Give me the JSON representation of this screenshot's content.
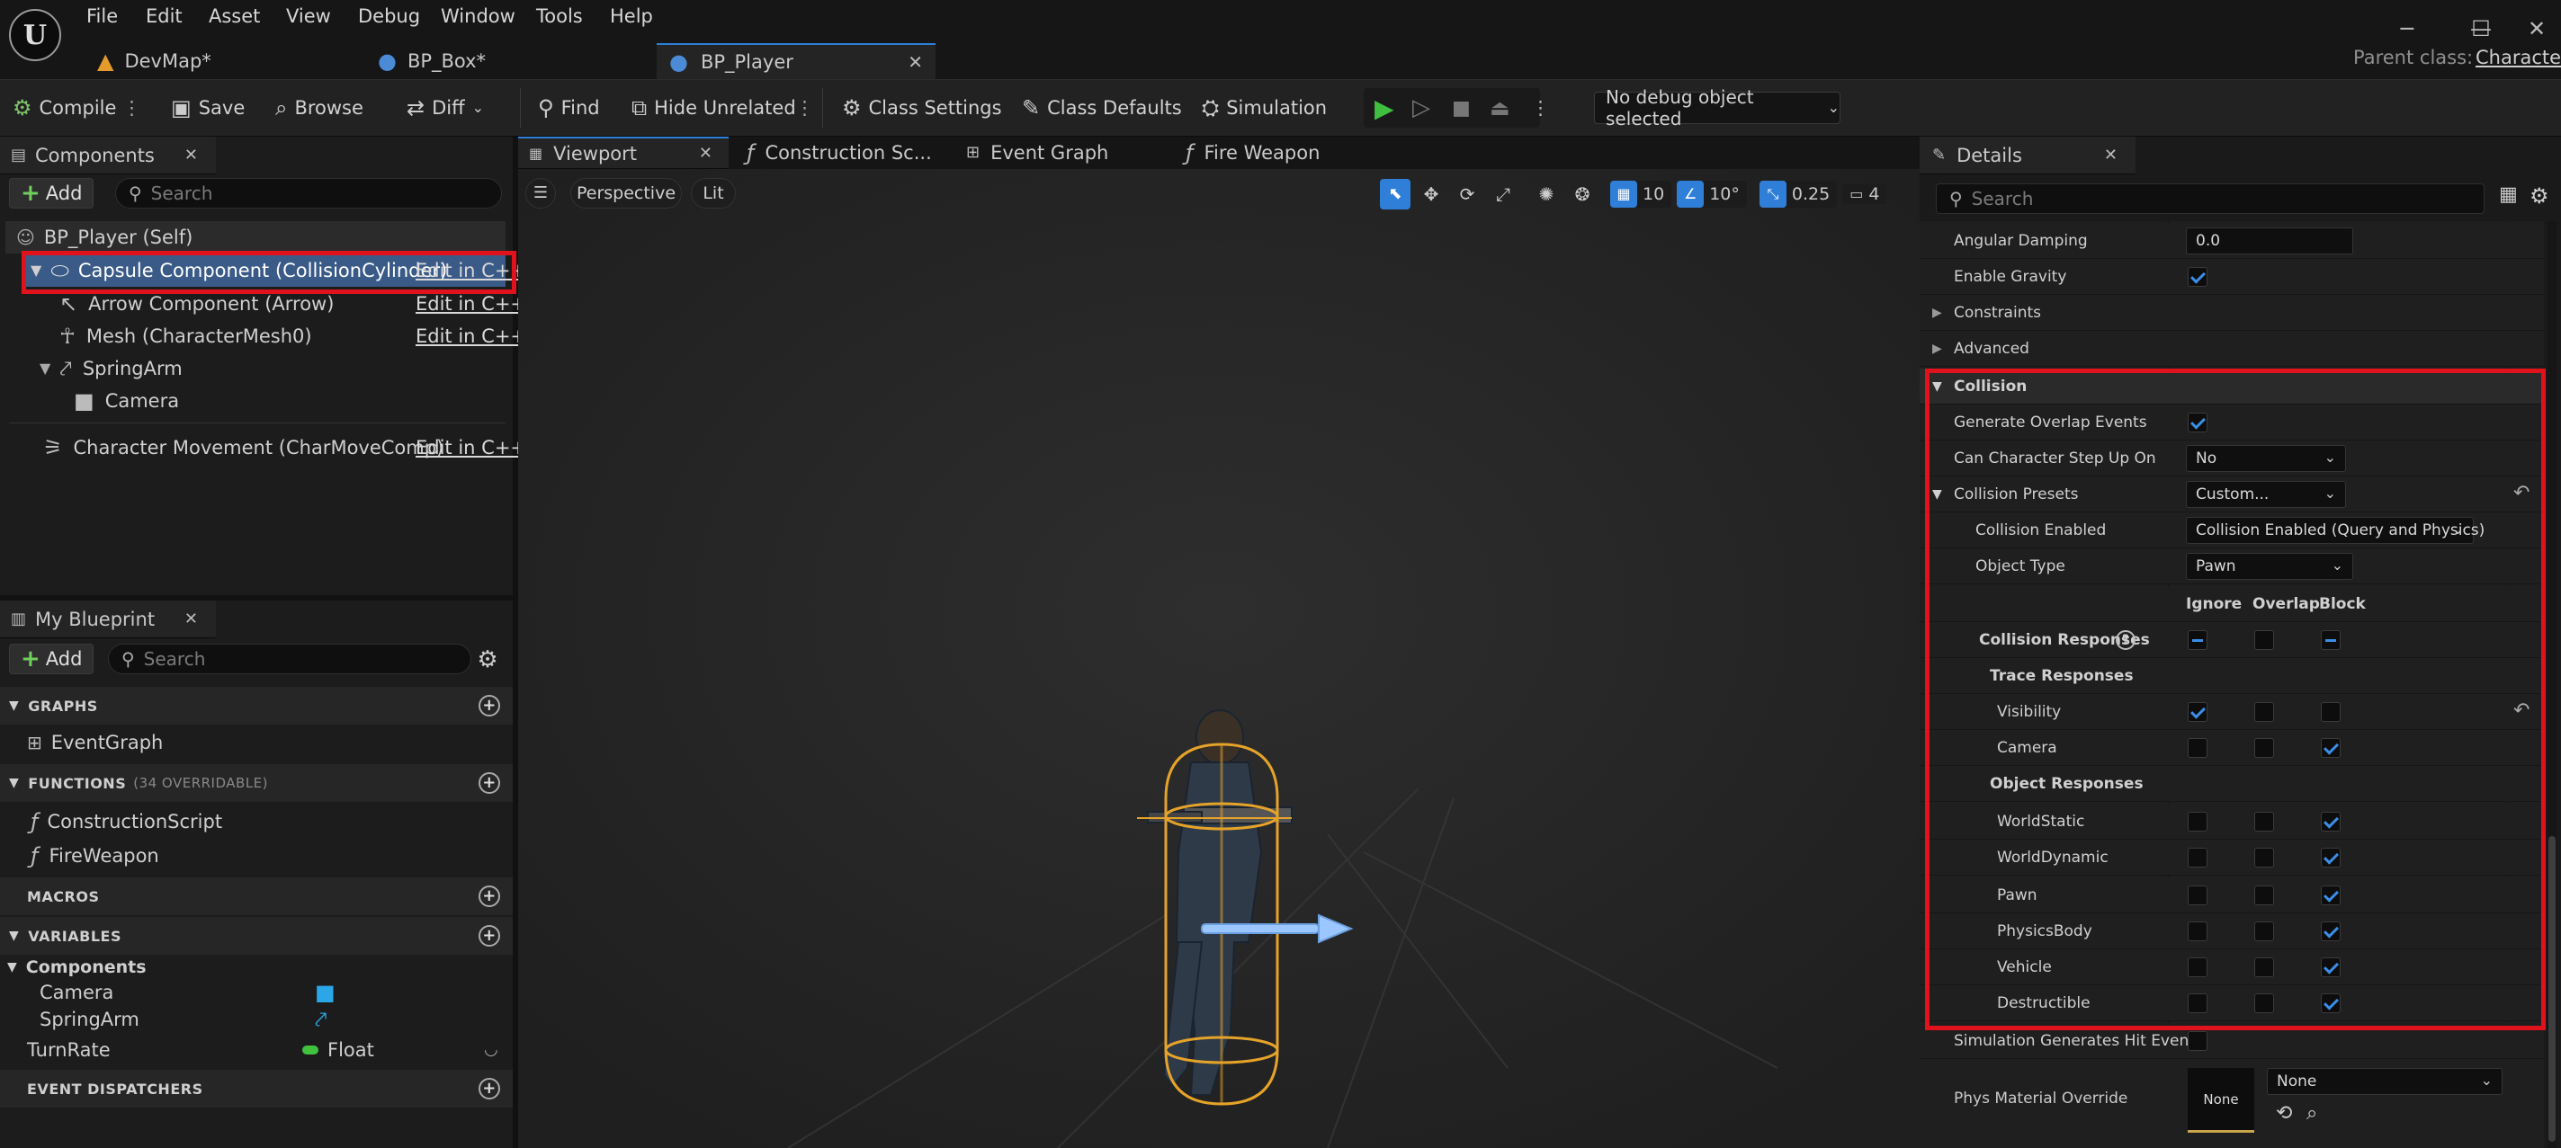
{
  "menu": [
    "File",
    "Edit",
    "Asset",
    "View",
    "Debug",
    "Window",
    "Tools",
    "Help"
  ],
  "tabs": [
    {
      "label": "DevMap*"
    },
    {
      "label": "BP_Box*"
    },
    {
      "label": "BP_Player"
    }
  ],
  "parent_class": {
    "label": "Parent class:",
    "value": "Character"
  },
  "toolbar": {
    "compile": "Compile",
    "save": "Save",
    "browse": "Browse",
    "diff": "Diff",
    "find": "Find",
    "hide_unrelated": "Hide Unrelated",
    "class_settings": "Class Settings",
    "class_defaults": "Class Defaults",
    "simulation": "Simulation",
    "debug_object": "No debug object selected"
  },
  "components": {
    "title": "Components",
    "add": "Add",
    "search_placeholder": "Search",
    "root": "BP_Player (Self)",
    "items": [
      {
        "label": "Capsule Component (CollisionCylinder)",
        "edit": "Edit in C++"
      },
      {
        "label": "Arrow Component (Arrow)",
        "edit": "Edit in C++"
      },
      {
        "label": "Mesh (CharacterMesh0)",
        "edit": "Edit in C++"
      },
      {
        "label": "SpringArm"
      },
      {
        "label": "Camera"
      },
      {
        "label": "Character Movement (CharMoveComp)",
        "edit": "Edit in C++"
      }
    ]
  },
  "my_blueprint": {
    "title": "My Blueprint",
    "add": "Add",
    "search_placeholder": "Search",
    "graphs": "GRAPHS",
    "event_graph": "EventGraph",
    "functions": "FUNCTIONS",
    "functions_sub": "(34 OVERRIDABLE)",
    "construction_script": "ConstructionScript",
    "fire_weapon": "FireWeapon",
    "macros": "MACROS",
    "variables": "VARIABLES",
    "components_group": "Components",
    "camera": "Camera",
    "springarm": "SpringArm",
    "turnrate": "TurnRate",
    "turnrate_type": "Float",
    "event_dispatchers": "EVENT DISPATCHERS"
  },
  "editor_tabs": [
    "Viewport",
    "Construction Sc...",
    "Event Graph",
    "Fire Weapon"
  ],
  "viewport": {
    "perspective": "Perspective",
    "lit": "Lit",
    "grid": "10",
    "angle": "10°",
    "scale": "0.25",
    "camera_speed": "4"
  },
  "details": {
    "title": "Details",
    "search_placeholder": "Search",
    "angular_damping": {
      "label": "Angular Damping",
      "value": "0.0"
    },
    "enable_gravity": {
      "label": "Enable Gravity",
      "checked": true
    },
    "constraints": "Constraints",
    "advanced": "Advanced",
    "collision": "Collision",
    "generate_overlap": {
      "label": "Generate Overlap Events",
      "checked": true
    },
    "step_up": {
      "label": "Can Character Step Up On",
      "value": "No"
    },
    "presets": {
      "label": "Collision Presets",
      "value": "Custom..."
    },
    "collision_enabled": {
      "label": "Collision Enabled",
      "value": "Collision Enabled (Query and Physics)"
    },
    "object_type": {
      "label": "Object Type",
      "value": "Pawn"
    },
    "col_headers": [
      "Ignore",
      "Overlap",
      "Block"
    ],
    "collision_responses": "Collision Responses",
    "trace_responses": "Trace Responses",
    "object_responses": "Object Responses",
    "trace": [
      {
        "label": "Visibility",
        "response": "Ignore"
      },
      {
        "label": "Camera",
        "response": "Block"
      }
    ],
    "objects": [
      {
        "label": "WorldStatic",
        "response": "Block"
      },
      {
        "label": "WorldDynamic",
        "response": "Block"
      },
      {
        "label": "Pawn",
        "response": "Block"
      },
      {
        "label": "PhysicsBody",
        "response": "Block"
      },
      {
        "label": "Vehicle",
        "response": "Block"
      },
      {
        "label": "Destructible",
        "response": "Block"
      }
    ],
    "sim_hit": {
      "label": "Simulation Generates Hit Events",
      "checked": false
    },
    "phys_material": {
      "label": "Phys Material Override",
      "thumb": "None",
      "value": "None"
    }
  },
  "colors": {
    "accent": "#2f7fd8",
    "highlight": "#e0121c",
    "check": "#3b8ee6",
    "play": "#3fbf3f"
  }
}
